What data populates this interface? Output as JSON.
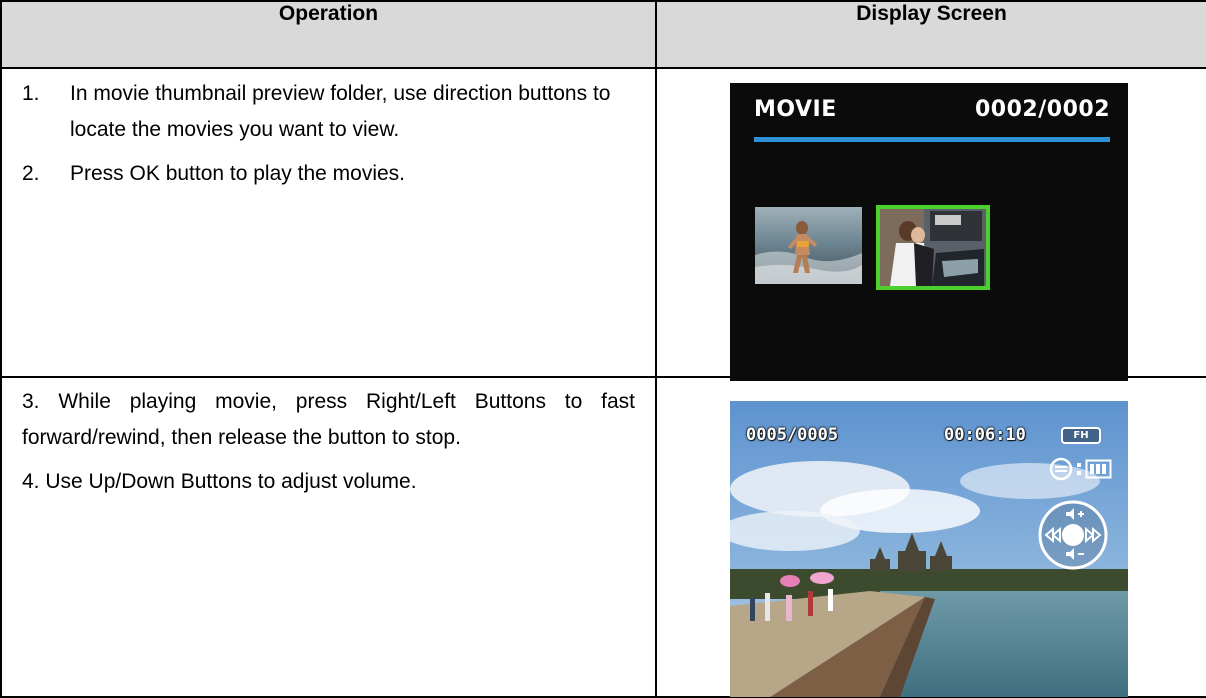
{
  "table": {
    "headers": [
      "Operation",
      "Display Screen"
    ],
    "rows": [
      {
        "steps": [
          {
            "num": "1.",
            "text": "In movie thumbnail preview folder, use direction buttons to locate the movies you want to view."
          },
          {
            "num": "2.",
            "text": "Press OK button to play the movies."
          }
        ],
        "screen": {
          "title": "MOVIE",
          "counter": "0002/0002",
          "accent_bar_color": "#2e92d6",
          "selected_border_color": "#4bd12d",
          "thumbnails": [
            "beach-running-child-thumbnail",
            "couple-selected-thumbnail"
          ]
        }
      },
      {
        "steps": [
          {
            "text": "3. While playing movie, press Right/Left Buttons to fast forward/rewind, then release the button to stop."
          },
          {
            "text": "4. Use Up/Down Buttons to adjust volume."
          }
        ],
        "screen": {
          "counter": "0005/0005",
          "time": "00:06:10",
          "quality_badge": "FH",
          "icons": [
            "recycle-mode-icon",
            "battery-icon",
            "playback-control-dial-icon"
          ]
        }
      }
    ]
  }
}
